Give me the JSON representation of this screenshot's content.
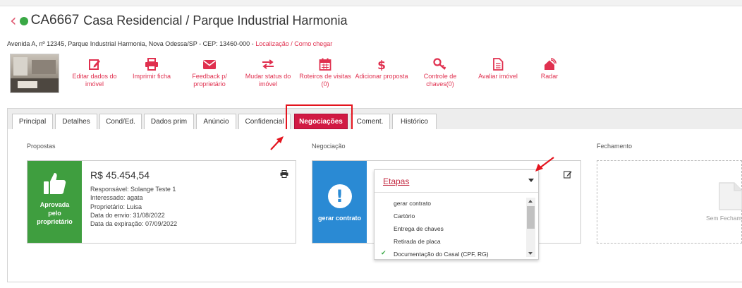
{
  "header": {
    "back_icon": "chevron-left-icon",
    "status_color": "#3aa845",
    "code": "CA6667",
    "title": "Casa Residencial / Parque Industrial Harmonia"
  },
  "address": {
    "text": "Avenida A, nº 12345, Parque Industrial Harmonia, Nova Odessa/SP - CEP: 13460-000 -",
    "link": "Localização / Como chegar"
  },
  "actions": [
    {
      "icon": "edit-icon",
      "label": "Editar dados do imóvel"
    },
    {
      "icon": "print-icon",
      "label": "Imprimir ficha"
    },
    {
      "icon": "envelope-icon",
      "label": "Feedback p/ proprietário"
    },
    {
      "icon": "exchange-icon",
      "label": "Mudar status do imóvel"
    },
    {
      "icon": "calendar-icon",
      "label": "Roteiros de visitas (0)"
    },
    {
      "icon": "dollar-icon",
      "label": "Adicionar proposta"
    },
    {
      "icon": "key-icon",
      "label": "Controle de chaves(0)"
    },
    {
      "icon": "document-icon",
      "label": "Avaliar imóvel"
    },
    {
      "icon": "radar-icon",
      "label": "Radar"
    }
  ],
  "accent_color": "#e0304f",
  "tabs": [
    {
      "label": "Principal"
    },
    {
      "label": "Detalhes"
    },
    {
      "label": "Cond/Ed."
    },
    {
      "label": "Dados prim"
    },
    {
      "label": "Anúncio"
    },
    {
      "label": "Confidencial"
    },
    {
      "label": "Negociações",
      "active": true
    },
    {
      "label": "Coment."
    },
    {
      "label": "Histórico"
    }
  ],
  "sections": {
    "proposals": "Propostas",
    "negotiation": "Negociação",
    "closing": "Fechamento"
  },
  "proposal_card": {
    "status_label": "Aprovada pelo proprietário",
    "status_color": "#3f9e3f",
    "price": "R$ 45.454,54",
    "lines": [
      "Responsável: Solange Teste 1",
      "Interessado: agata",
      "Proprietário: Luisa",
      "Data do envio: 31/08/2022",
      "Data da expiração: 07/09/2022"
    ]
  },
  "negotiation_card": {
    "status_label": "gerar contrato",
    "status_color": "#2a8ad4"
  },
  "dropdown": {
    "title": "Etapas",
    "items": [
      {
        "label": "gerar contrato",
        "checked": false
      },
      {
        "label": "Cartório",
        "checked": false
      },
      {
        "label": "Entrega de chaves",
        "checked": false
      },
      {
        "label": "Retirada de placa",
        "checked": false
      },
      {
        "label": "Documentação do Casal (CPF, RG)",
        "checked": true
      }
    ]
  },
  "closing_card": {
    "empty_label": "Sem Fechamento"
  }
}
